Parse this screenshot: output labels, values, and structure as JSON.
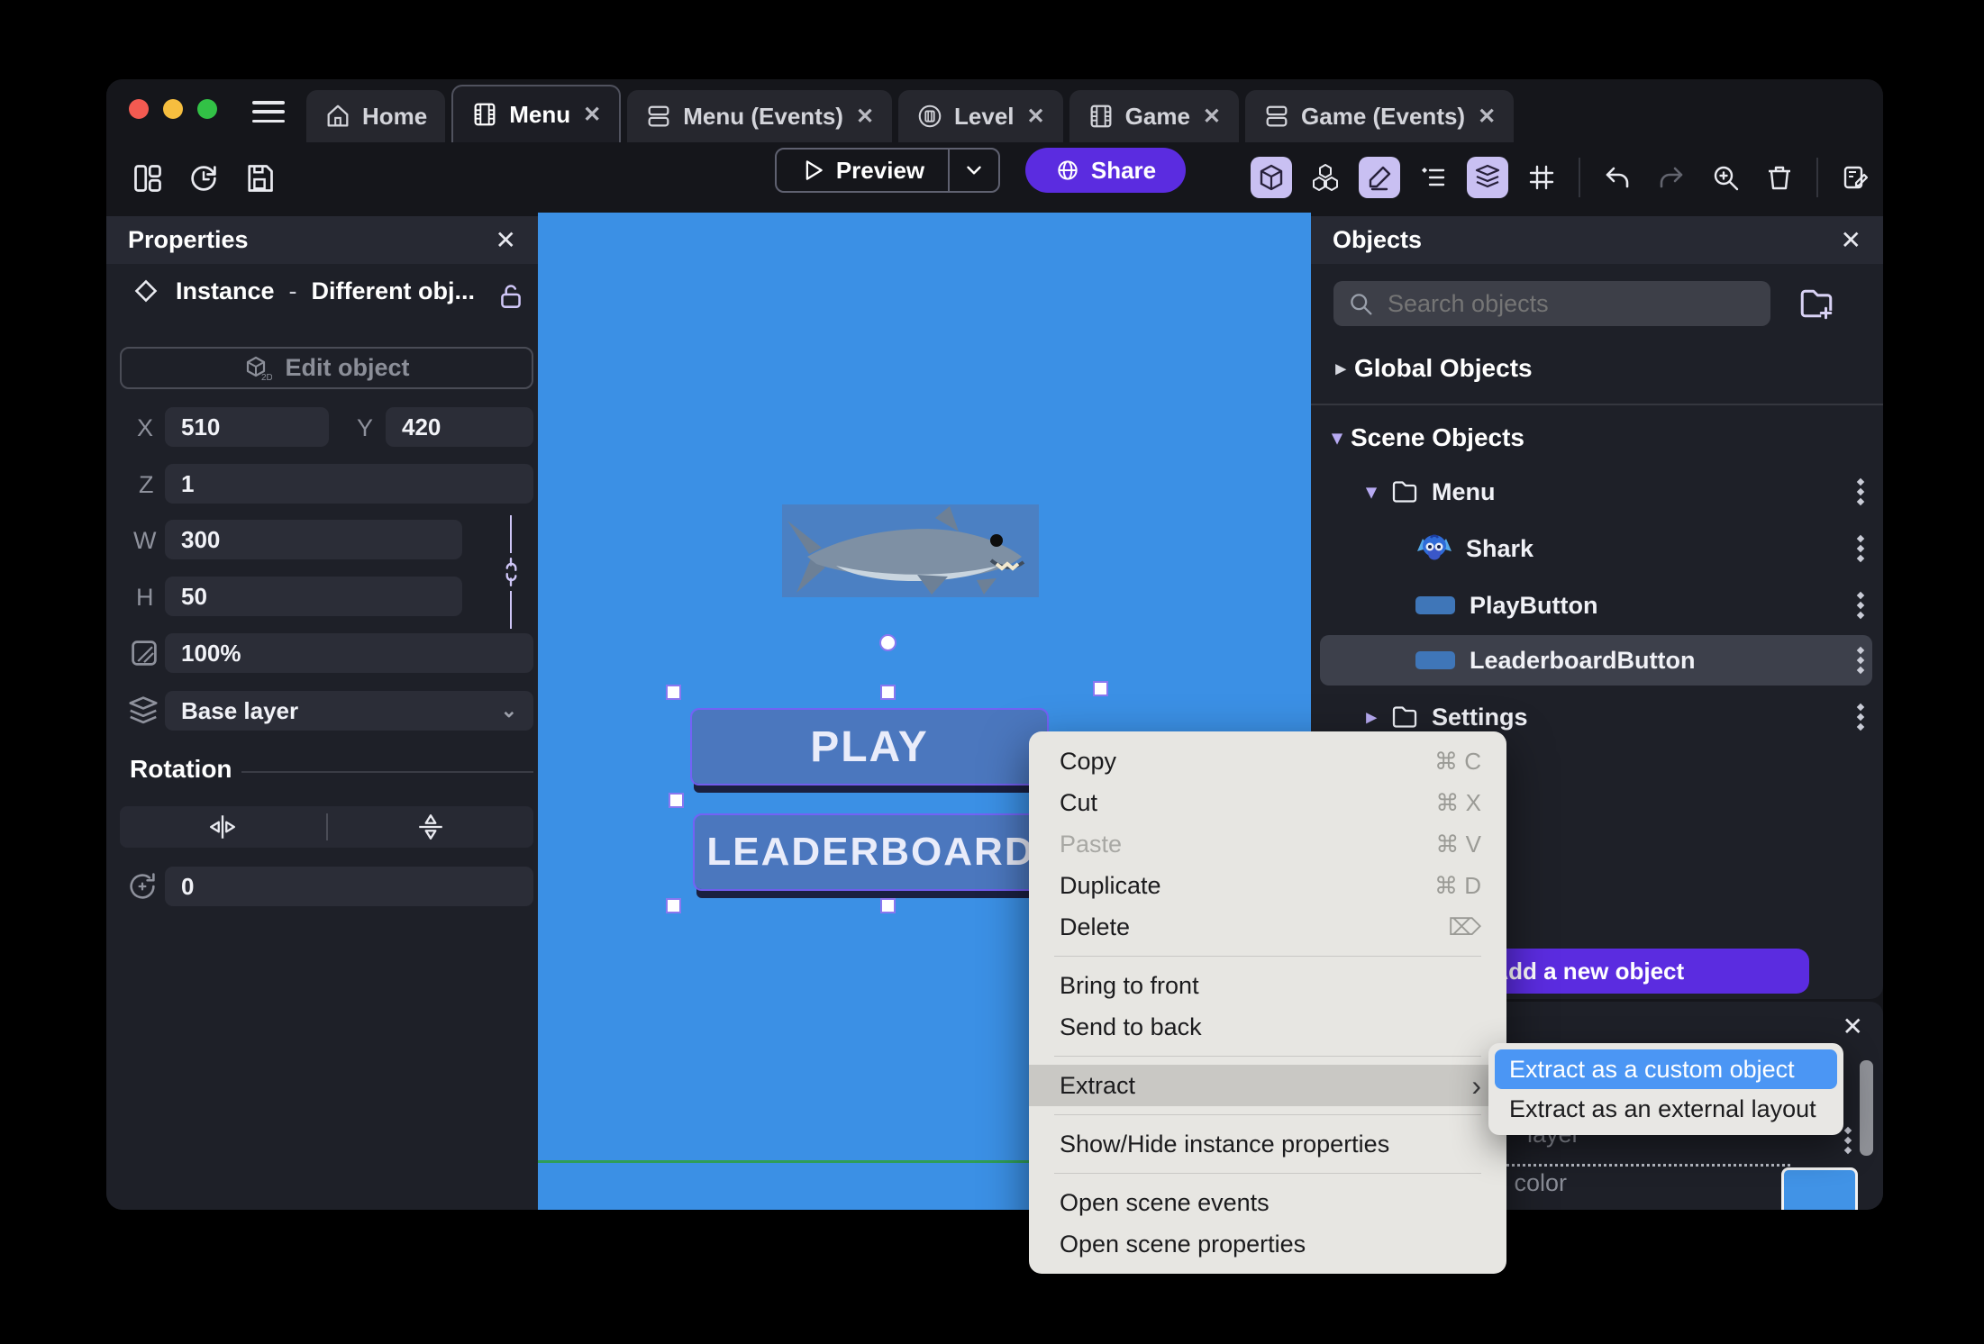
{
  "colors": {
    "accent_purple": "#5b2ce0",
    "highlight_lavender": "#c9c0f2",
    "canvas_blue": "#3b90e5",
    "sprite_bg_blue": "#4b80c3",
    "game_button_blue": "#4b77be",
    "game_button_shadow": "#1a2040",
    "selection_purple": "#8a77f0",
    "menu_highlight_blue": "#4b96f4",
    "background_color_swatch": "#4193e6",
    "scene_boundary_green": "#2f9d58",
    "traffic_red": "#f35a51",
    "traffic_yellow": "#f6be3f",
    "traffic_green": "#32c146"
  },
  "icons": {
    "close": "✕",
    "caret_down": "▾",
    "caret_right": "▸",
    "chevron_down": "⌄",
    "submenu_chevron": "›",
    "delete_key": "⌦",
    "plus": "+",
    "dash": "-"
  },
  "titlebar": {
    "tabs": [
      {
        "label": "Home",
        "icon": "home-icon",
        "active": false,
        "closable": false
      },
      {
        "label": "Menu",
        "icon": "scene-icon",
        "active": true,
        "closable": true
      },
      {
        "label": "Menu (Events)",
        "icon": "events-icon",
        "active": false,
        "closable": true
      },
      {
        "label": "Level",
        "icon": "external-layout-icon",
        "active": false,
        "closable": true
      },
      {
        "label": "Game",
        "icon": "scene-icon",
        "active": false,
        "closable": true
      },
      {
        "label": "Game (Events)",
        "icon": "events-icon",
        "active": false,
        "closable": true
      }
    ]
  },
  "toolbar": {
    "preview_label": "Preview",
    "share_label": "Share"
  },
  "properties": {
    "title": "Properties",
    "instance_type": "Instance",
    "separator": "-",
    "instance_object": "Different obj...",
    "edit_object_label": "Edit object",
    "x_label": "X",
    "x_value": "510",
    "y_label": "Y",
    "y_value": "420",
    "z_label": "Z",
    "z_value": "1",
    "w_label": "W",
    "w_value": "300",
    "h_label": "H",
    "h_value": "50",
    "opacity_value": "100%",
    "layer_value": "Base layer",
    "rotation_title": "Rotation",
    "angle_value": "0"
  },
  "canvas": {
    "play_label": "PLAY",
    "leaderboard_label": "LEADERBOARD"
  },
  "objects": {
    "title": "Objects",
    "search_placeholder": "Search objects",
    "global_section": "Global Objects",
    "scene_section": "Scene Objects",
    "tree": [
      {
        "label": "Menu",
        "type": "folder",
        "expanded": true
      },
      {
        "label": "Shark",
        "type": "sprite"
      },
      {
        "label": "PlayButton",
        "type": "panel-sprite"
      },
      {
        "label": "LeaderboardButton",
        "type": "panel-sprite",
        "selected": true
      },
      {
        "label": "Settings",
        "type": "folder",
        "expanded": false
      }
    ],
    "add_button_label": "Add a new object"
  },
  "context_menu": {
    "items": [
      {
        "label": "Copy",
        "shortcut": "⌘ C"
      },
      {
        "label": "Cut",
        "shortcut": "⌘ X"
      },
      {
        "label": "Paste",
        "shortcut": "⌘ V",
        "disabled": true
      },
      {
        "label": "Duplicate",
        "shortcut": "⌘ D"
      },
      {
        "label": "Delete",
        "shortcut": "⌦"
      },
      {
        "label": "Bring to front"
      },
      {
        "label": "Send to back"
      },
      {
        "label": "Extract",
        "has_submenu": true,
        "highlighted": true,
        "chevron": "›"
      },
      {
        "label": "Show/Hide instance properties"
      },
      {
        "label": "Open scene events"
      },
      {
        "label": "Open scene properties"
      }
    ]
  },
  "submenu": {
    "items": [
      {
        "label": "Extract as a custom object",
        "selected": true
      },
      {
        "label": "Extract as an external layout",
        "selected": false
      }
    ]
  },
  "layers_panel": {
    "layer_fragment": "layer",
    "color_fragment": "d color"
  }
}
